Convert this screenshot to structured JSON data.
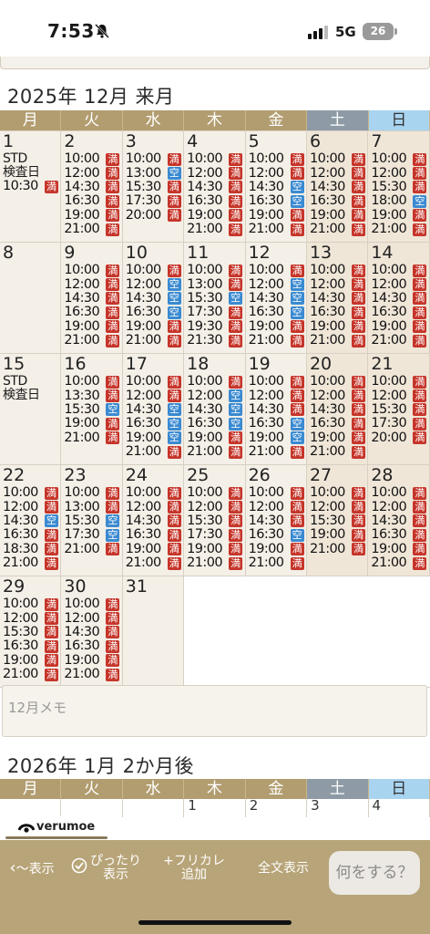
{
  "status": {
    "time": "7:53",
    "network": "5G",
    "battery": "26"
  },
  "month1": {
    "title": "2025年 12月 来月",
    "weekdays": [
      "月",
      "火",
      "水",
      "木",
      "金",
      "土",
      "日"
    ],
    "weeks": [
      [
        {
          "day": "1",
          "note": [
            "STD",
            "検査日"
          ],
          "slots": [
            [
              "10:30",
              "満"
            ]
          ]
        },
        {
          "day": "2",
          "slots": [
            [
              "10:00",
              "満"
            ],
            [
              "12:00",
              "満"
            ],
            [
              "14:30",
              "満"
            ],
            [
              "16:30",
              "満"
            ],
            [
              "19:00",
              "満"
            ],
            [
              "21:00",
              "満"
            ]
          ]
        },
        {
          "day": "3",
          "slots": [
            [
              "10:00",
              "満"
            ],
            [
              "13:00",
              "空"
            ],
            [
              "15:30",
              "満"
            ],
            [
              "17:30",
              "満"
            ],
            [
              "20:00",
              "満"
            ]
          ]
        },
        {
          "day": "4",
          "slots": [
            [
              "10:00",
              "満"
            ],
            [
              "12:00",
              "満"
            ],
            [
              "14:30",
              "満"
            ],
            [
              "16:30",
              "満"
            ],
            [
              "19:00",
              "満"
            ],
            [
              "21:00",
              "満"
            ]
          ]
        },
        {
          "day": "5",
          "slots": [
            [
              "10:00",
              "満"
            ],
            [
              "12:00",
              "満"
            ],
            [
              "14:30",
              "空"
            ],
            [
              "16:30",
              "空"
            ],
            [
              "19:00",
              "満"
            ],
            [
              "21:00",
              "満"
            ]
          ]
        },
        {
          "day": "6",
          "slots": [
            [
              "10:00",
              "満"
            ],
            [
              "12:00",
              "満"
            ],
            [
              "14:30",
              "満"
            ],
            [
              "16:30",
              "満"
            ],
            [
              "19:00",
              "満"
            ],
            [
              "21:00",
              "満"
            ]
          ]
        },
        {
          "day": "7",
          "slots": [
            [
              "10:00",
              "満"
            ],
            [
              "12:00",
              "満"
            ],
            [
              "15:30",
              "満"
            ],
            [
              "18:00",
              "空"
            ],
            [
              "19:00",
              "満"
            ],
            [
              "21:00",
              "満"
            ]
          ]
        }
      ],
      [
        {
          "day": "8",
          "slots": []
        },
        {
          "day": "9",
          "slots": [
            [
              "10:00",
              "満"
            ],
            [
              "12:00",
              "満"
            ],
            [
              "14:30",
              "満"
            ],
            [
              "16:30",
              "満"
            ],
            [
              "19:00",
              "満"
            ],
            [
              "21:00",
              "満"
            ]
          ]
        },
        {
          "day": "10",
          "slots": [
            [
              "10:00",
              "満"
            ],
            [
              "12:00",
              "空"
            ],
            [
              "14:30",
              "空"
            ],
            [
              "16:30",
              "空"
            ],
            [
              "19:00",
              "満"
            ],
            [
              "21:00",
              "満"
            ]
          ]
        },
        {
          "day": "11",
          "slots": [
            [
              "10:00",
              "満"
            ],
            [
              "13:00",
              "満"
            ],
            [
              "15:30",
              "空"
            ],
            [
              "17:30",
              "満"
            ],
            [
              "19:30",
              "満"
            ],
            [
              "21:30",
              "満"
            ]
          ]
        },
        {
          "day": "12",
          "slots": [
            [
              "10:00",
              "満"
            ],
            [
              "12:00",
              "空"
            ],
            [
              "14:30",
              "空"
            ],
            [
              "16:30",
              "空"
            ],
            [
              "19:00",
              "満"
            ],
            [
              "21:00",
              "満"
            ]
          ]
        },
        {
          "day": "13",
          "slots": [
            [
              "10:00",
              "満"
            ],
            [
              "12:00",
              "満"
            ],
            [
              "14:30",
              "満"
            ],
            [
              "16:30",
              "満"
            ],
            [
              "19:00",
              "満"
            ],
            [
              "21:00",
              "満"
            ]
          ]
        },
        {
          "day": "14",
          "slots": [
            [
              "10:00",
              "満"
            ],
            [
              "12:00",
              "満"
            ],
            [
              "14:30",
              "満"
            ],
            [
              "16:30",
              "満"
            ],
            [
              "19:00",
              "満"
            ],
            [
              "21:00",
              "満"
            ]
          ]
        }
      ],
      [
        {
          "day": "15",
          "note": [
            "STD",
            "検査日"
          ],
          "slots": []
        },
        {
          "day": "16",
          "slots": [
            [
              "10:00",
              "満"
            ],
            [
              "13:30",
              "満"
            ],
            [
              "15:30",
              "空"
            ],
            [
              "19:00",
              "満"
            ],
            [
              "21:00",
              "満"
            ]
          ]
        },
        {
          "day": "17",
          "slots": [
            [
              "10:00",
              "満"
            ],
            [
              "12:00",
              "満"
            ],
            [
              "14:30",
              "空"
            ],
            [
              "16:30",
              "空"
            ],
            [
              "19:00",
              "空"
            ],
            [
              "21:00",
              "満"
            ]
          ]
        },
        {
          "day": "18",
          "slots": [
            [
              "10:00",
              "満"
            ],
            [
              "12:00",
              "空"
            ],
            [
              "14:30",
              "空"
            ],
            [
              "16:30",
              "空"
            ],
            [
              "19:00",
              "満"
            ],
            [
              "21:00",
              "満"
            ]
          ]
        },
        {
          "day": "19",
          "slots": [
            [
              "10:00",
              "満"
            ],
            [
              "12:00",
              "満"
            ],
            [
              "14:30",
              "満"
            ],
            [
              "16:30",
              "空"
            ],
            [
              "19:00",
              "空"
            ],
            [
              "21:00",
              "満"
            ]
          ]
        },
        {
          "day": "20",
          "slots": [
            [
              "10:00",
              "満"
            ],
            [
              "12:00",
              "満"
            ],
            [
              "14:30",
              "満"
            ],
            [
              "16:30",
              "満"
            ],
            [
              "19:00",
              "満"
            ],
            [
              "21:00",
              "満"
            ]
          ]
        },
        {
          "day": "21",
          "slots": [
            [
              "10:00",
              "満"
            ],
            [
              "12:00",
              "満"
            ],
            [
              "15:30",
              "満"
            ],
            [
              "17:30",
              "満"
            ],
            [
              "20:00",
              "満"
            ]
          ]
        }
      ],
      [
        {
          "day": "22",
          "slots": [
            [
              "10:00",
              "満"
            ],
            [
              "12:00",
              "満"
            ],
            [
              "14:30",
              "空"
            ],
            [
              "16:30",
              "満"
            ],
            [
              "18:30",
              "満"
            ],
            [
              "21:00",
              "満"
            ]
          ]
        },
        {
          "day": "23",
          "slots": [
            [
              "10:00",
              "満"
            ],
            [
              "13:00",
              "満"
            ],
            [
              "15:30",
              "空"
            ],
            [
              "17:30",
              "空"
            ],
            [
              "21:00",
              "満"
            ]
          ]
        },
        {
          "day": "24",
          "slots": [
            [
              "10:00",
              "満"
            ],
            [
              "12:00",
              "満"
            ],
            [
              "14:30",
              "満"
            ],
            [
              "16:30",
              "満"
            ],
            [
              "19:00",
              "満"
            ],
            [
              "21:00",
              "満"
            ]
          ]
        },
        {
          "day": "25",
          "slots": [
            [
              "10:00",
              "満"
            ],
            [
              "12:00",
              "満"
            ],
            [
              "15:30",
              "満"
            ],
            [
              "17:30",
              "満"
            ],
            [
              "19:00",
              "満"
            ],
            [
              "21:00",
              "満"
            ]
          ]
        },
        {
          "day": "26",
          "slots": [
            [
              "10:00",
              "満"
            ],
            [
              "12:00",
              "満"
            ],
            [
              "14:30",
              "満"
            ],
            [
              "16:30",
              "空"
            ],
            [
              "19:00",
              "満"
            ],
            [
              "21:00",
              "満"
            ]
          ]
        },
        {
          "day": "27",
          "slots": [
            [
              "10:00",
              "満"
            ],
            [
              "12:00",
              "満"
            ],
            [
              "15:30",
              "満"
            ],
            [
              "19:00",
              "満"
            ],
            [
              "21:00",
              "満"
            ]
          ]
        },
        {
          "day": "28",
          "slots": [
            [
              "10:00",
              "満"
            ],
            [
              "12:00",
              "満"
            ],
            [
              "14:30",
              "満"
            ],
            [
              "16:30",
              "満"
            ],
            [
              "19:00",
              "満"
            ],
            [
              "21:00",
              "満"
            ]
          ]
        }
      ],
      [
        {
          "day": "29",
          "slots": [
            [
              "10:00",
              "満"
            ],
            [
              "12:00",
              "満"
            ],
            [
              "15:30",
              "満"
            ],
            [
              "16:30",
              "満"
            ],
            [
              "19:00",
              "満"
            ],
            [
              "21:00",
              "満"
            ]
          ]
        },
        {
          "day": "30",
          "slots": [
            [
              "10:00",
              "満"
            ],
            [
              "12:00",
              "満"
            ],
            [
              "14:30",
              "満"
            ],
            [
              "16:30",
              "満"
            ],
            [
              "19:00",
              "満"
            ],
            [
              "21:00",
              "満"
            ]
          ]
        },
        {
          "day": "31",
          "slots": []
        },
        {
          "empty": true
        },
        {
          "empty": true
        },
        {
          "empty": true
        },
        {
          "empty": true
        }
      ]
    ]
  },
  "memo": {
    "placeholder": "12月メモ"
  },
  "month2": {
    "title": "2026年 1月 2か月後",
    "weekdays": [
      "月",
      "火",
      "水",
      "木",
      "金",
      "土",
      "日"
    ],
    "first_days": [
      "",
      "",
      "",
      "1",
      "2",
      "3",
      "4"
    ]
  },
  "logo": {
    "text": "verumoe"
  },
  "toolbar": {
    "back_label": "〜表示",
    "fit_label_1": "ぴったり",
    "fit_label_2": "表示",
    "add_label_1": "+フリカレ",
    "add_label_2": "追加",
    "fulltext_label": "全文表示",
    "ask_label": "何をする？"
  },
  "colors": {
    "full": "#c6352a",
    "free": "#3a8ad1",
    "header": "#b29d70",
    "toolbar": "#b7a478"
  }
}
